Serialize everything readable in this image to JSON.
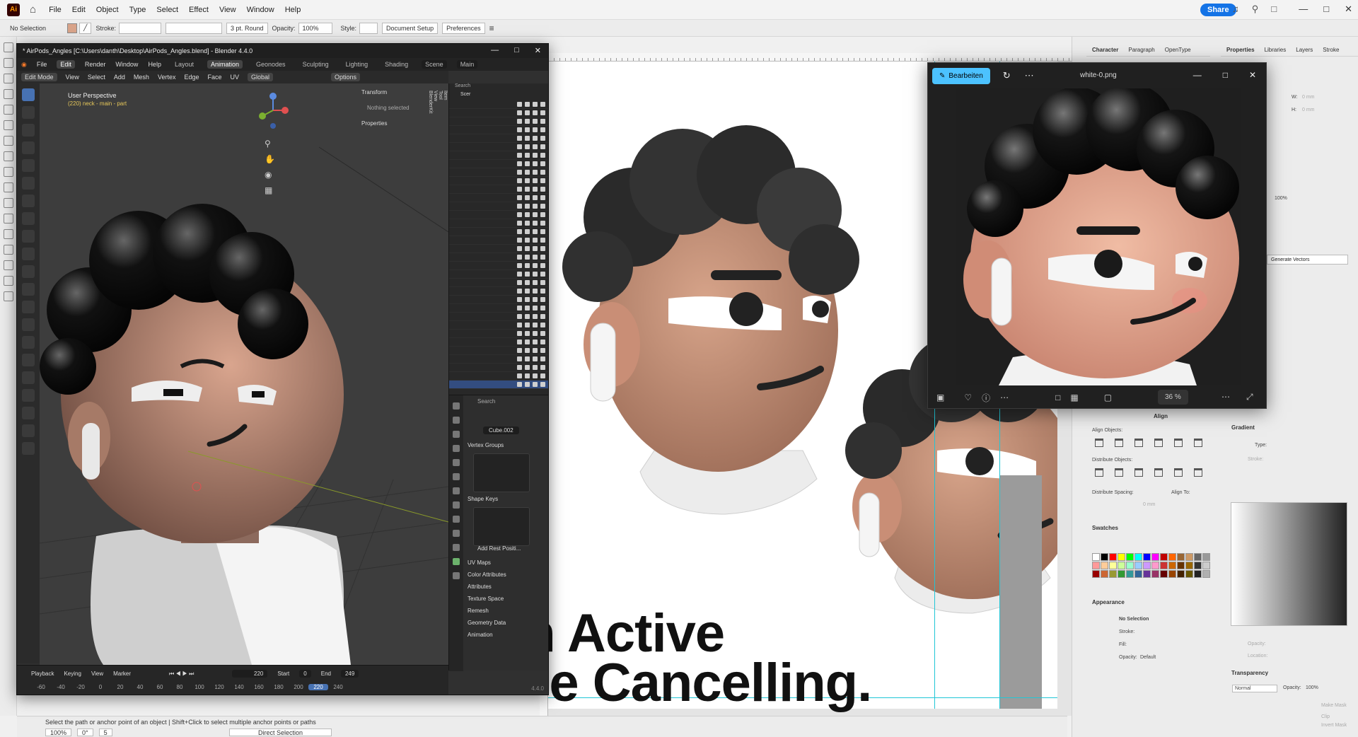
{
  "illustrator": {
    "logo": "Ai",
    "menu": [
      "File",
      "Edit",
      "Object",
      "Type",
      "Select",
      "Effect",
      "View",
      "Window",
      "Help"
    ],
    "share_label": "Share",
    "control": {
      "selection": "No Selection",
      "stroke_label": "Stroke:",
      "brush": "3 pt. Round",
      "opacity_label": "Opacity:",
      "opacity_value": "100%",
      "style_label": "Style:",
      "document_setup": "Document Setup",
      "preferences": "Preferences"
    },
    "canvas": {
      "headline_line1": "th Active",
      "headline_line2": "ice Cancelling."
    },
    "status": {
      "hint": "Select the path or anchor point of an object  |  Shift+Click to select multiple anchor points or paths",
      "zoom": "100%",
      "rotation": "0°",
      "artboard": "5",
      "mode": "Direct Selection"
    },
    "right_panels": {
      "char_tabs": [
        "Character",
        "Paragraph",
        "OpenType"
      ],
      "prop_tabs": [
        "Properties",
        "Libraries",
        "Layers",
        "Stroke"
      ],
      "w_label": "W:",
      "h_label": "H:",
      "w_value": "0 mm",
      "h_value": "0 mm",
      "percent_field": "100%",
      "generate_vectors": "Generate Vectors",
      "align": {
        "title": "Align",
        "align_objects": "Align Objects:",
        "distribute_objects": "Distribute Objects:",
        "distribute_spacing": "Distribute Spacing:",
        "align_to": "Align To:",
        "spacing_value": "0 mm"
      },
      "gradient": {
        "title": "Gradient",
        "type_label": "Type:",
        "stroke_label": "Stroke:",
        "opacity_label": "Opacity:",
        "location_label": "Location:"
      },
      "swatches_title": "Swatches",
      "appearance": {
        "title": "Appearance",
        "no_selection": "No Selection",
        "stroke": "Stroke:",
        "fill": "Fill:",
        "opacity": "Opacity:",
        "opacity_value": "Default"
      },
      "transparency": {
        "title": "Transparency",
        "mode": "Normal",
        "opacity_label": "Opacity:",
        "opacity_value": "100%",
        "make_mask": "Make Mask",
        "clip": "Clip",
        "invert_mask": "Invert Mask"
      },
      "swatch_colors": [
        "#ffffff",
        "#000000",
        "#ff0000",
        "#ffff00",
        "#00ff00",
        "#00ffff",
        "#0000ff",
        "#ff00ff",
        "#c00000",
        "#ff6600",
        "#996633",
        "#cc9966",
        "#666666",
        "#999999",
        "#ff9999",
        "#ffcc99",
        "#ffff99",
        "#ccff99",
        "#99ffcc",
        "#99ccff",
        "#cc99ff",
        "#ff99cc",
        "#cc3333",
        "#cc6600",
        "#663300",
        "#996600",
        "#333333",
        "#cccccc",
        "#990000",
        "#cc6633",
        "#999933",
        "#339933",
        "#339999",
        "#336699",
        "#663399",
        "#993366",
        "#660000",
        "#994400",
        "#442200",
        "#665500",
        "#222222",
        "#b0b0b0"
      ]
    }
  },
  "blender": {
    "title": "* AirPods_Angles [C:\\Users\\danth\\Desktop\\AirPods_Angles.blend] - Blender 4.4.0",
    "menu": [
      "File",
      "Edit",
      "Render",
      "Window",
      "Help"
    ],
    "workspaces": [
      "Layout",
      "Animation",
      "Geonodes",
      "Sculpting",
      "Lighting",
      "Shading"
    ],
    "scene": "Scene",
    "view_layer": "Main",
    "header": [
      "Edit Mode",
      "View",
      "Select",
      "Add",
      "Mesh",
      "Vertex",
      "Edge",
      "Face",
      "UV"
    ],
    "orientation": "Global",
    "options": "Options",
    "viewport": {
      "perspective": "User Perspective",
      "object": "(220) neck - main - part"
    },
    "npanel": {
      "transform": "Transform",
      "nothing_selected": "Nothing selected",
      "properties": "Properties",
      "tabs": [
        "Item",
        "Tool",
        "View",
        "BlenderKit"
      ]
    },
    "outliner": {
      "search": "Search",
      "scene_label": "Scer"
    },
    "properties": {
      "search": "Search",
      "object_name": "Cube.002",
      "sections": [
        "Vertex Groups",
        "Shape Keys",
        "Add Rest Positi...",
        "UV Maps",
        "Color Attributes",
        "Attributes",
        "Texture Space",
        "Remesh",
        "Geometry Data",
        "Animation"
      ]
    },
    "timeline": {
      "menus": [
        "Playback",
        "Keying",
        "View",
        "Marker"
      ],
      "current": "220",
      "start_label": "Start",
      "start": "0",
      "end_label": "End",
      "end": "249",
      "frames": [
        "-60",
        "-40",
        "-20",
        "0",
        "20",
        "40",
        "60",
        "80",
        "100",
        "120",
        "140",
        "160",
        "180",
        "200",
        "220",
        "240"
      ]
    },
    "version": "4.4.0"
  },
  "photos": {
    "edit_label": "Bearbeiten",
    "filename": "white-0.png",
    "zoom": "36 %"
  }
}
